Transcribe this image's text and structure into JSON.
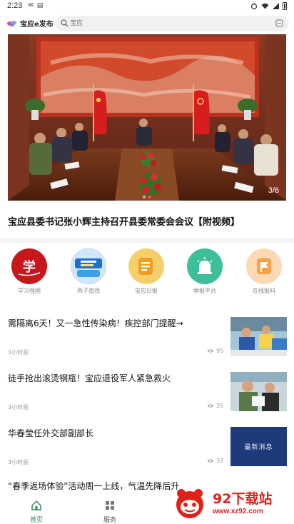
{
  "status_bar": {
    "time": "2:23",
    "left_icons": [
      "mail-icon",
      "clipboard-icon"
    ],
    "right_icons": [
      "vibrate-icon",
      "wifi-icon",
      "signal-icon",
      "battery-icon"
    ]
  },
  "header": {
    "logo_text": "宝应e发布",
    "search_placeholder": "宝应",
    "icons": [
      "search-icon",
      "scan-icon"
    ]
  },
  "banner": {
    "counter": "3/6",
    "active_index": 3,
    "total": 6
  },
  "headline": "宝应县委书记张小辉主持召开县委常委会会议【附视频】",
  "quick_menu": [
    {
      "label": "学习强国",
      "icon": "xuexi-logo",
      "bg": "#c8161d"
    },
    {
      "label": "丙子南戏",
      "icon": "promo-badge",
      "bg": "#2f7fd8"
    },
    {
      "label": "宝应日报",
      "icon": "newspaper-icon",
      "bg": "#f7b733"
    },
    {
      "label": "举报平台",
      "icon": "alarm-icon",
      "bg": "#3dbf9c"
    },
    {
      "label": "在线报料",
      "icon": "flag-icon",
      "bg": "#f6a24b"
    }
  ],
  "news": [
    {
      "title": "需隔离6天！又一急性传染病！疾控部门提醒→",
      "time": "3小时前",
      "views": "95"
    },
    {
      "title": "徒手抢出滚烫钢瓶！宝应退役军人紧急救火",
      "time": "3小时前",
      "views": "35"
    },
    {
      "title": "华春莹任外交部副部长",
      "time": "3小时前",
      "views": "37",
      "thumb_text": "最新消息"
    },
    {
      "title": "“春季返场体验”活动周一上线，气温先降后升"
    }
  ],
  "bottom_nav": [
    {
      "label": "首页",
      "icon": "home-icon",
      "active": true
    },
    {
      "label": "服务",
      "icon": "grid-icon",
      "active": false
    }
  ],
  "watermark": {
    "title": "92下载站",
    "url": "www.xz92.com"
  },
  "colors": {
    "active_nav": "#2a8a5a",
    "watermark_red": "#e0211a",
    "banner_dot_active": "#ff5050"
  }
}
